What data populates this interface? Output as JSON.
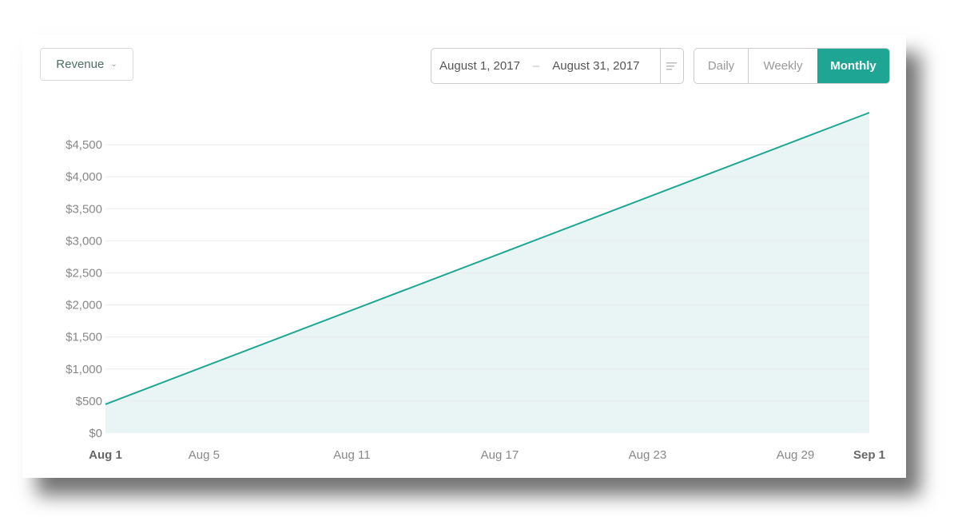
{
  "controls": {
    "metric": "Revenue",
    "date_start": "August 1, 2017",
    "date_separator": "–",
    "date_end": "August 31, 2017",
    "periods": [
      "Daily",
      "Weekly",
      "Monthly"
    ],
    "selected_period": "Monthly"
  },
  "colors": {
    "accent": "#1fa593",
    "fill": "#e8f5f4"
  },
  "chart_data": {
    "type": "area",
    "x": [
      "2017-08-01",
      "2017-09-01"
    ],
    "values": [
      450,
      5000
    ],
    "ylim": [
      0,
      5000
    ],
    "yticks": [
      0,
      500,
      1000,
      1500,
      2000,
      2500,
      3000,
      3500,
      4000,
      4500
    ],
    "ytick_labels": [
      "$0",
      "$500",
      "$1,000",
      "$1,500",
      "$2,000",
      "$2,500",
      "$3,000",
      "$3,500",
      "$4,000",
      "$4,500"
    ],
    "xticks": [
      {
        "date": "2017-08-01",
        "label": "Aug 1",
        "bold": true
      },
      {
        "date": "2017-08-05",
        "label": "Aug 5",
        "bold": false
      },
      {
        "date": "2017-08-11",
        "label": "Aug 11",
        "bold": false
      },
      {
        "date": "2017-08-17",
        "label": "Aug 17",
        "bold": false
      },
      {
        "date": "2017-08-23",
        "label": "Aug 23",
        "bold": false
      },
      {
        "date": "2017-08-29",
        "label": "Aug 29",
        "bold": false
      },
      {
        "date": "2017-09-01",
        "label": "Sep 1",
        "bold": true
      }
    ],
    "grid": true
  }
}
